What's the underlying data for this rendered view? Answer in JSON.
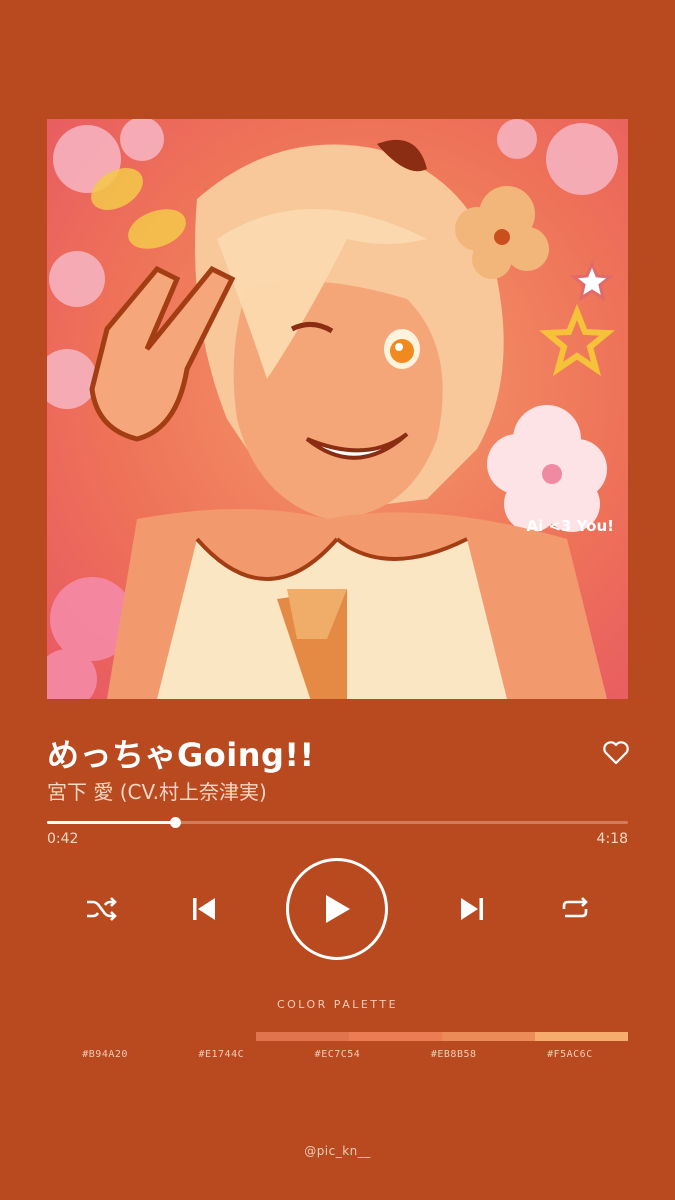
{
  "artwork": {
    "caption": "Ai <3 You!"
  },
  "track": {
    "title": "めっちゃGoing!!",
    "artist": "宮下 愛 (CV.村上奈津実)",
    "favorite_icon": "heart-outline-icon"
  },
  "progress": {
    "elapsed": "0:42",
    "total": "4:18",
    "fraction": 0.22
  },
  "controls": {
    "shuffle_icon": "shuffle-icon",
    "previous_icon": "skip-previous-icon",
    "play_icon": "play-icon",
    "next_icon": "skip-next-icon",
    "repeat_icon": "repeat-icon"
  },
  "palette": {
    "label": "COLOR PALETTE",
    "colors": [
      "#B94A20",
      "#E1744C",
      "#EC7C54",
      "#EB8B58",
      "#F5AC6C"
    ],
    "labels": [
      "#B94A20",
      "#E1744C",
      "#EC7C54",
      "#EB8B58",
      "#F5AC6C"
    ]
  },
  "credit": "@pic_kn__"
}
